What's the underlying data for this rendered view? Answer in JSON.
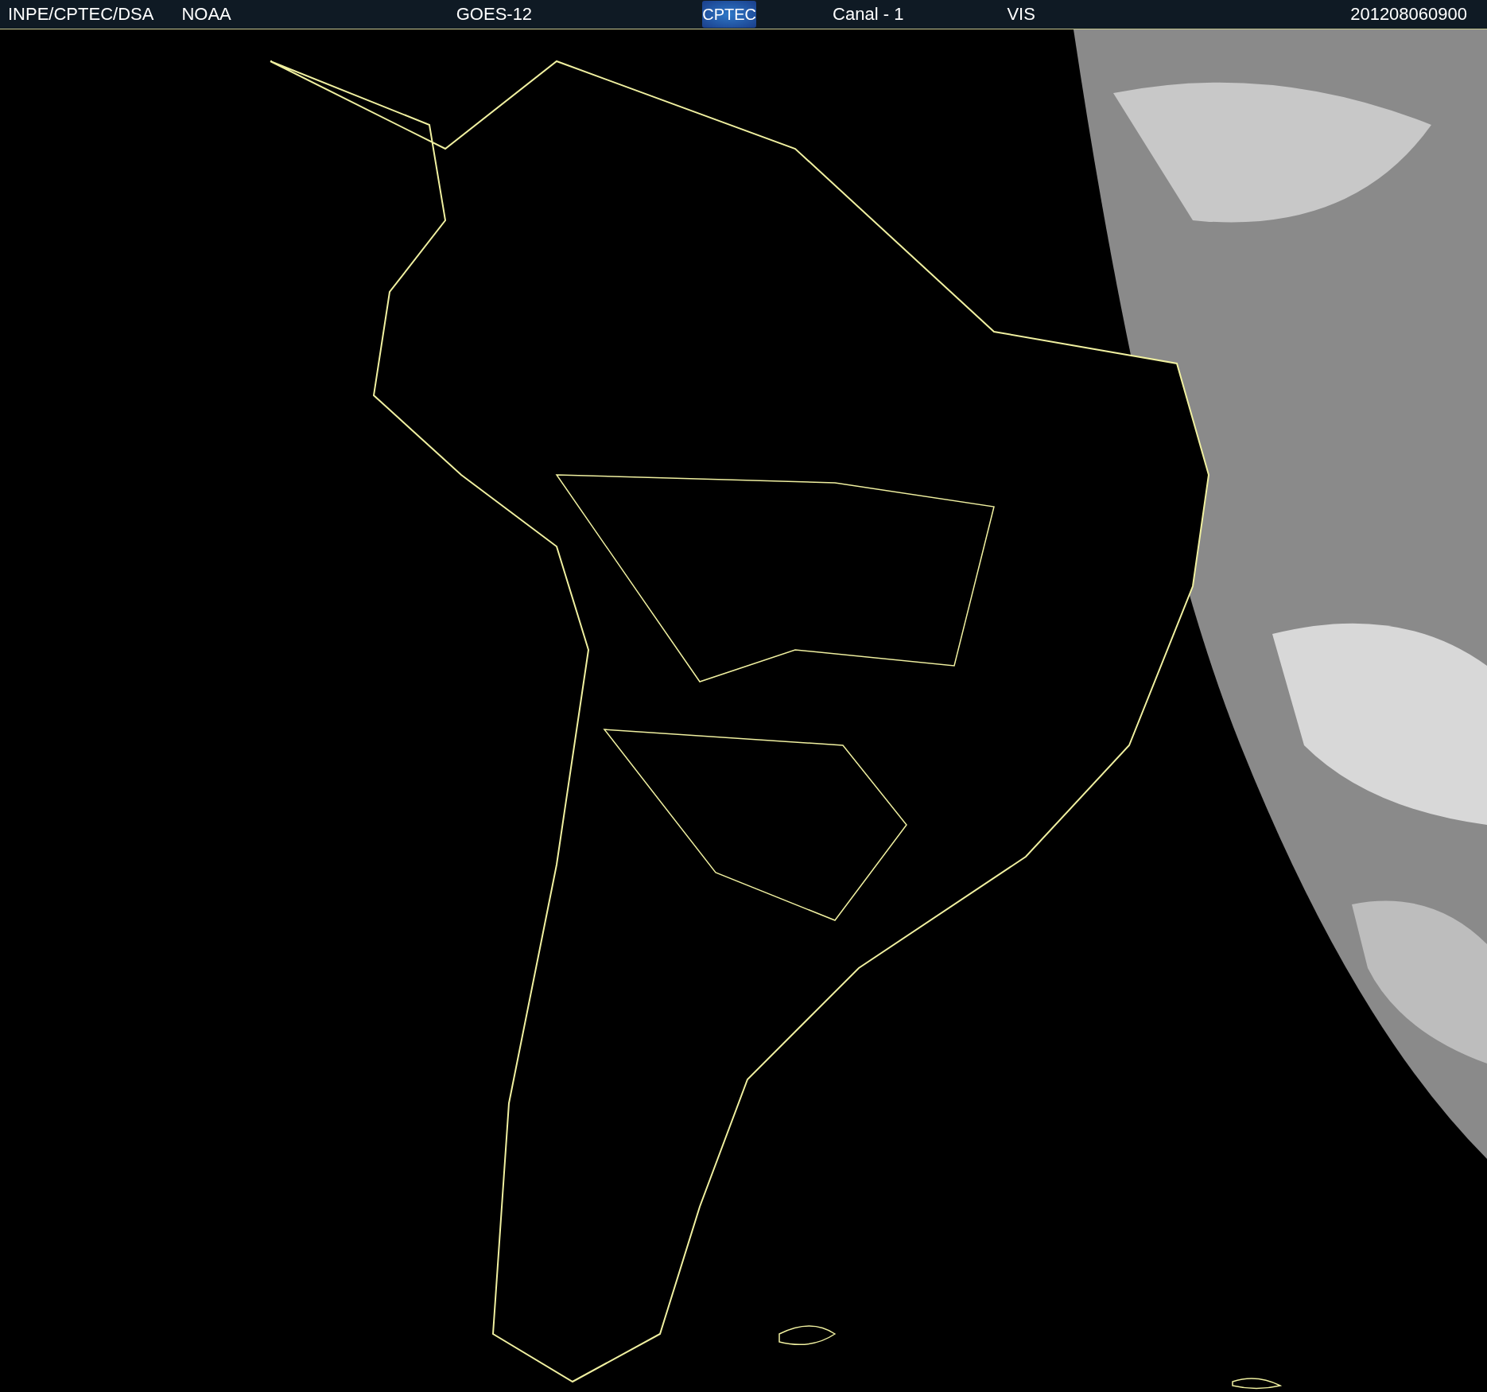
{
  "header": {
    "source": "INPE/CPTEC/DSA",
    "agency": "NOAA",
    "satellite": "GOES-12",
    "logo": "CPTEC",
    "channel": "Canal - 1",
    "band": "VIS",
    "timestamp": "201208060900"
  }
}
